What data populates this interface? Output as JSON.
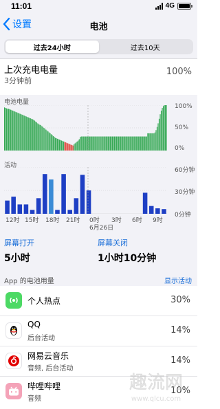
{
  "status_bar": {
    "time": "11:01",
    "network": "4G"
  },
  "nav": {
    "back_label": "设置",
    "title": "电池"
  },
  "segments": [
    {
      "label": "过去24小时",
      "active": true
    },
    {
      "label": "过去10天",
      "active": false
    }
  ],
  "last_charge": {
    "label": "上次充电电量",
    "time_ago": "3分钟前",
    "value": "100%"
  },
  "battery_chart": {
    "title": "电池电量",
    "y_labels": [
      "100%",
      "50%",
      "0%"
    ]
  },
  "activity_chart": {
    "title": "活动",
    "y_labels": [
      "60分钟",
      "30分钟",
      "0分钟"
    ],
    "x_labels": [
      "12时",
      "15时",
      "18时",
      "21时",
      "0时",
      "3时",
      "6时",
      "9时"
    ],
    "date_label": "6月26日"
  },
  "screen": {
    "on_label": "屏幕打开",
    "on_value": "5小时",
    "off_label": "屏幕关闭",
    "off_value": "1小时10分钟"
  },
  "usage": {
    "title": "App 的电池用量",
    "show_activity": "显示活动",
    "apps": [
      {
        "name": "个人热点",
        "sub": "",
        "percent": "30%",
        "icon": "hotspot-icon",
        "color": "#4cd964"
      },
      {
        "name": "QQ",
        "sub": "后台活动",
        "percent": "14%",
        "icon": "penguin-icon",
        "color": "#ffffff"
      },
      {
        "name": "网易云音乐",
        "sub": "音频, 后台活动",
        "percent": "14%",
        "icon": "music-icon",
        "color": "#ffffff"
      },
      {
        "name": "哔哩哔哩",
        "sub": "音频",
        "percent": "10%",
        "icon": "tv-icon",
        "color": "#f4a3b8"
      }
    ]
  },
  "watermark": {
    "text": "趣流网",
    "url": "www.qlcu.com"
  },
  "colors": {
    "accent": "#007aff",
    "battery_green": "#34a853",
    "battery_red": "#e0463a",
    "activity_dark": "#1e3fc4",
    "activity_light": "#3a8bd6"
  },
  "chart_data": [
    {
      "type": "bar",
      "title": "电池电量",
      "unit": "%",
      "ylim": [
        0,
        100
      ],
      "values": [
        95,
        94,
        93,
        92,
        92,
        91,
        90,
        89,
        88,
        87,
        86,
        85,
        84,
        83,
        82,
        81,
        80,
        79,
        78,
        77,
        76,
        75,
        74,
        73,
        72,
        71,
        70,
        69,
        68,
        66,
        64,
        62,
        60,
        58,
        57,
        56,
        54,
        52,
        50,
        48,
        46,
        44,
        42,
        40,
        38,
        36,
        34,
        32,
        30,
        28,
        27,
        26,
        25,
        24,
        23,
        22,
        21,
        20,
        19,
        18,
        17,
        16,
        15,
        14,
        13,
        12,
        11,
        14,
        16,
        18,
        20,
        22,
        25,
        30,
        31,
        31,
        31,
        31,
        31,
        31,
        31,
        31,
        31,
        31,
        31,
        31,
        31,
        31,
        31,
        31,
        31,
        31,
        31,
        31,
        31,
        31,
        31,
        31,
        31,
        31,
        31,
        31,
        31,
        31,
        31,
        31,
        31,
        31,
        31,
        31,
        31,
        31,
        31,
        31,
        31,
        31,
        31,
        31,
        31,
        31,
        31,
        31,
        31,
        31,
        31,
        31,
        31,
        31,
        31,
        31,
        31,
        31,
        31,
        31,
        31,
        31,
        31,
        31,
        38,
        38,
        38,
        38,
        38,
        38,
        38,
        40,
        45,
        52,
        60,
        70,
        80,
        88,
        94,
        98,
        100,
        100,
        100
      ],
      "low_range": [
        58,
        66
      ]
    },
    {
      "type": "bar",
      "title": "活动",
      "unit": "分钟",
      "ylim": [
        0,
        60
      ],
      "series": [
        {
          "name": "屏幕打开",
          "values": [
            17,
            22,
            12,
            12,
            5,
            20,
            51,
            44,
            5,
            51,
            5,
            20,
            50,
            30,
            0,
            0,
            0,
            0,
            0,
            0,
            0,
            0,
            27,
            10,
            7,
            6
          ]
        },
        {
          "name": "屏幕关闭",
          "values": [
            0,
            0,
            5,
            0,
            0,
            0,
            0,
            0,
            0,
            0,
            0,
            0,
            0,
            0,
            0,
            0,
            0,
            0,
            0,
            0,
            0,
            0,
            0,
            0,
            0,
            0
          ]
        }
      ]
    }
  ]
}
